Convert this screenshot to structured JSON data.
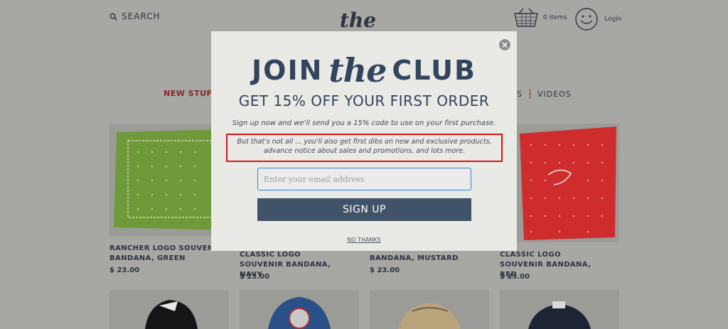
{
  "header": {
    "search_label": "SEARCH",
    "logo_text": "the",
    "cart_label": "0 items",
    "login_label": "Login"
  },
  "nav": {
    "left_item": "NEW STUFF",
    "right_fragment": "S",
    "right_item": "VIDEOS",
    "accent_color": "#8a2424"
  },
  "products": [
    {
      "name": "RANCHER LOGO SOUVENIR BANDANA, GREEN",
      "price": "$ 23.00",
      "color": "#6f9a3a"
    },
    {
      "name": "CLASSIC LOGO SOUVENIR BANDANA, NAVY",
      "price": "$ 23.00",
      "color": "#2f3b5c"
    },
    {
      "name": "BANDANA, MUSTARD",
      "price": "$ 23.00",
      "color": "#c49b3c"
    },
    {
      "name": "CLASSIC LOGO SOUVENIR BANDANA, RED",
      "price": "$ 23.00",
      "color": "#cf2d2d"
    }
  ],
  "modal": {
    "headline_left": "JOIN",
    "headline_script": "the",
    "headline_right": "CLUB",
    "subheadline": "GET 15% OFF YOUR FIRST ORDER",
    "body_line1": "Sign up now and we'll send you a 15% code to use on your first purchase.",
    "body_line2": "But that's not all ... you'll also get first dibs on new and exclusive products, advance notice about sales and promotions, and lots more.",
    "email_placeholder": "Enter your email address",
    "signup_label": "SIGN UP",
    "no_thanks_label": "NO THANKS",
    "close_symbol": "×",
    "brand_color": "#34445c",
    "highlight_color": "#d8141a"
  }
}
